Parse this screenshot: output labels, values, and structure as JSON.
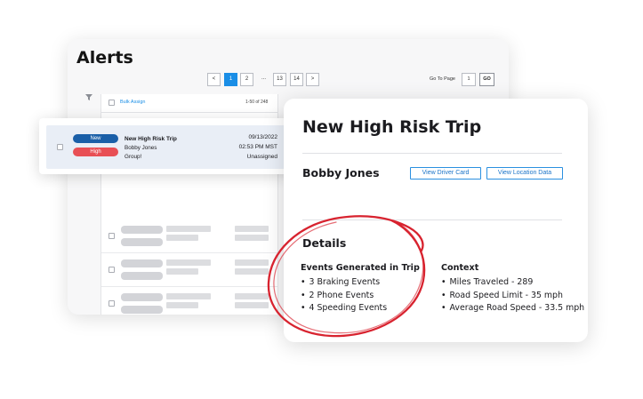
{
  "alerts": {
    "title": "Alerts",
    "pagination": {
      "prev": "<",
      "pages": [
        "1",
        "2",
        "...",
        "13",
        "14"
      ],
      "next": ">",
      "goto_label": "Go To Page",
      "goto_value": "1",
      "go_button": "GO"
    },
    "bulk_assign": "Bulk Assign",
    "count_text": "1-50 of 248"
  },
  "alert_row": {
    "status_badge": "New",
    "priority_badge": "High",
    "title": "New High Risk Trip",
    "driver": "Bobby Jones",
    "group": "Group!",
    "date": "09/13/2022",
    "time": "02:53 PM MST",
    "assignment": "Unassigned"
  },
  "trip_card": {
    "title": "New High Risk Trip",
    "driver_name": "Bobby Jones",
    "view_driver_card": "View Driver Card",
    "view_location_data": "View Location Data",
    "details_heading": "Details",
    "events": {
      "heading": "Events Generated in Trip",
      "items": [
        "3 Braking Events",
        "2 Phone Events",
        "4 Speeding Events"
      ]
    },
    "context": {
      "heading": "Context",
      "items": [
        "Miles Traveled - 289",
        "Road Speed Limit - 35 mph",
        "Average Road Speed - 33.5 mph"
      ]
    }
  },
  "colors": {
    "accent_blue": "#1a8ee6",
    "badge_new": "#1a5fa8",
    "badge_high": "#e84f55",
    "annotation_red": "#d8232f"
  },
  "icons": [
    "filter-icon",
    "chevron-left-icon",
    "chevron-right-icon"
  ]
}
